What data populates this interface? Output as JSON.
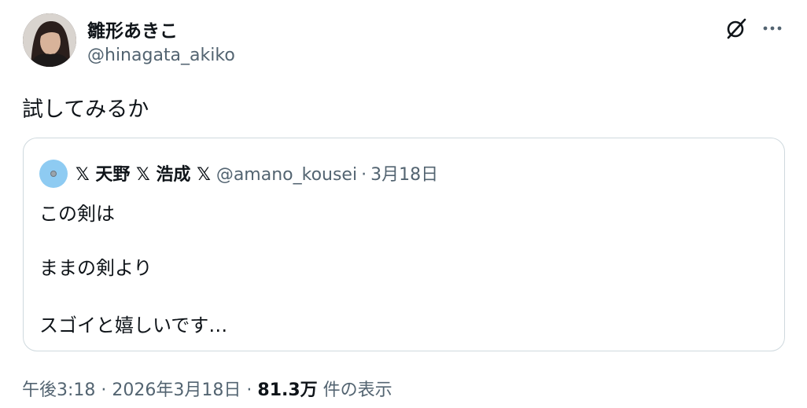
{
  "author": {
    "display_name": "雛形あきこ",
    "handle": "@hinagata_akiko",
    "avatar_icon": "profile-photo"
  },
  "actions": {
    "grok_icon": "grok-icon",
    "more_icon": "more-horizontal-icon"
  },
  "tweet": {
    "text": "試してみるか"
  },
  "quoted": {
    "display_name": "𝕏 天野 𝕏 浩成 𝕏",
    "handle": "@amano_kousei",
    "separator": "·",
    "date": "3月18日",
    "lines": [
      "この剣は",
      "ままの剣より",
      "スゴイと嬉しいです…"
    ]
  },
  "meta": {
    "time": "午後3:18",
    "separator": "·",
    "date": "2026年3月18日",
    "views_count": "81.3万",
    "views_label": "件の表示"
  }
}
